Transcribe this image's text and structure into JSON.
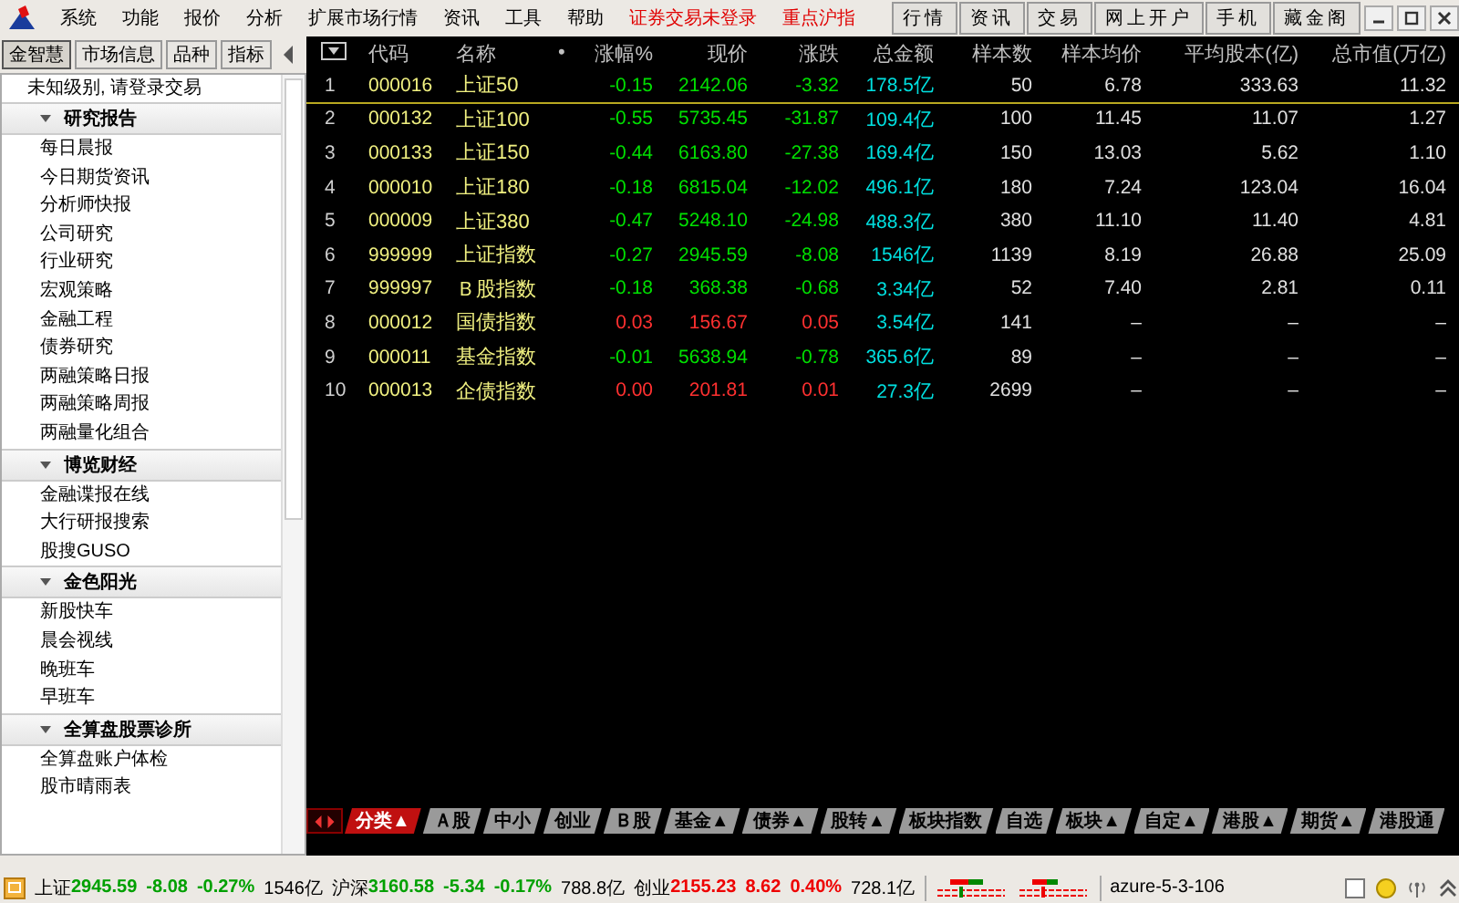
{
  "menu": [
    "系统",
    "功能",
    "报价",
    "分析",
    "扩展市场行情",
    "资讯",
    "工具",
    "帮助"
  ],
  "alerts": [
    "证券交易未登录",
    "重点沪指"
  ],
  "toolbar": [
    "行情",
    "资讯",
    "交易",
    "网上开户",
    "手机",
    "藏金阁"
  ],
  "sidebar": {
    "tabs": [
      {
        "label": "金智慧",
        "selected": true
      },
      {
        "label": "市场信息",
        "selected": false
      },
      {
        "label": "品种",
        "selected": false
      },
      {
        "label": "指标",
        "selected": false
      }
    ],
    "notice": "未知级别, 请登录交易",
    "sections": [
      {
        "title": "研究报告",
        "expanded": true,
        "children": [
          "每日晨报",
          "今日期货资讯",
          "分析师快报",
          "公司研究",
          "行业研究",
          "宏观策略",
          "金融工程",
          "债券研究",
          "两融策略日报",
          "两融策略周报",
          "两融量化组合"
        ]
      },
      {
        "title": "博览财经",
        "expanded": true,
        "children": [
          "金融谍报在线",
          "大行研报搜索",
          "股搜GUSO"
        ]
      },
      {
        "title": "金色阳光",
        "expanded": true,
        "children": [
          "新股快车",
          "晨会视线",
          "晚班车",
          "早班车"
        ]
      },
      {
        "title": "全算盘股票诊所",
        "expanded": true,
        "children": [
          "全算盘账户体检",
          "股市晴雨表"
        ]
      }
    ]
  },
  "table": {
    "columns": [
      "代码",
      "名称",
      "•",
      "涨幅%",
      "现价",
      "涨跌",
      "总金额",
      "样本数",
      "样本均价",
      "平均股本(亿)",
      "总市值(万亿)"
    ],
    "rows": [
      {
        "no": "1",
        "code": "000016",
        "name": "上证50",
        "pct": "-0.15",
        "price": "2142.06",
        "change": "-3.32",
        "amount": "178.5",
        "unit": "亿",
        "samples": "50",
        "avg_price": "6.78",
        "avg_cap": "333.63",
        "market_cap": "11.32",
        "rising": false,
        "selected": true
      },
      {
        "no": "2",
        "code": "000132",
        "name": "上证100",
        "pct": "-0.55",
        "price": "5735.45",
        "change": "-31.87",
        "amount": "109.4",
        "unit": "亿",
        "samples": "100",
        "avg_price": "11.45",
        "avg_cap": "11.07",
        "market_cap": "1.27",
        "rising": false,
        "selected": false
      },
      {
        "no": "3",
        "code": "000133",
        "name": "上证150",
        "pct": "-0.44",
        "price": "6163.80",
        "change": "-27.38",
        "amount": "169.4",
        "unit": "亿",
        "samples": "150",
        "avg_price": "13.03",
        "avg_cap": "5.62",
        "market_cap": "1.10",
        "rising": false,
        "selected": false
      },
      {
        "no": "4",
        "code": "000010",
        "name": "上证180",
        "pct": "-0.18",
        "price": "6815.04",
        "change": "-12.02",
        "amount": "496.1",
        "unit": "亿",
        "samples": "180",
        "avg_price": "7.24",
        "avg_cap": "123.04",
        "market_cap": "16.04",
        "rising": false,
        "selected": false
      },
      {
        "no": "5",
        "code": "000009",
        "name": "上证380",
        "pct": "-0.47",
        "price": "5248.10",
        "change": "-24.98",
        "amount": "488.3",
        "unit": "亿",
        "samples": "380",
        "avg_price": "11.10",
        "avg_cap": "11.40",
        "market_cap": "4.81",
        "rising": false,
        "selected": false
      },
      {
        "no": "6",
        "code": "999999",
        "name": "上证指数",
        "pct": "-0.27",
        "price": "2945.59",
        "change": "-8.08",
        "amount": "1546",
        "unit": "亿",
        "samples": "1139",
        "avg_price": "8.19",
        "avg_cap": "26.88",
        "market_cap": "25.09",
        "rising": false,
        "selected": false
      },
      {
        "no": "7",
        "code": "999997",
        "name": "Ｂ股指数",
        "pct": "-0.18",
        "price": "368.38",
        "change": "-0.68",
        "amount": "3.34",
        "unit": "亿",
        "samples": "52",
        "avg_price": "7.40",
        "avg_cap": "2.81",
        "market_cap": "0.11",
        "rising": false,
        "selected": false
      },
      {
        "no": "8",
        "code": "000012",
        "name": "国债指数",
        "pct": "0.03",
        "price": "156.67",
        "change": "0.05",
        "amount": "3.54",
        "unit": "亿",
        "samples": "141",
        "avg_price": "–",
        "avg_cap": "–",
        "market_cap": "–",
        "rising": true,
        "selected": false
      },
      {
        "no": "9",
        "code": "000011",
        "name": "基金指数",
        "pct": "-0.01",
        "price": "5638.94",
        "change": "-0.78",
        "amount": "365.6",
        "unit": "亿",
        "samples": "89",
        "avg_price": "–",
        "avg_cap": "–",
        "market_cap": "–",
        "rising": false,
        "selected": false
      },
      {
        "no": "10",
        "code": "000013",
        "name": "企债指数",
        "pct": "0.00",
        "price": "201.81",
        "change": "0.01",
        "amount": "27.3",
        "unit": "亿",
        "samples": "2699",
        "avg_price": "–",
        "avg_cap": "–",
        "market_cap": "–",
        "rising": true,
        "selected": false
      }
    ]
  },
  "bottom_tabs": [
    {
      "label": "分类▲",
      "selected": true
    },
    {
      "label": "Ａ股",
      "selected": false
    },
    {
      "label": "中小",
      "selected": false
    },
    {
      "label": "创业",
      "selected": false
    },
    {
      "label": "Ｂ股",
      "selected": false
    },
    {
      "label": "基金▲",
      "selected": false
    },
    {
      "label": "债券▲",
      "selected": false
    },
    {
      "label": "股转▲",
      "selected": false
    },
    {
      "label": "板块指数",
      "selected": false
    },
    {
      "label": "自选",
      "selected": false
    },
    {
      "label": "板块▲",
      "selected": false
    },
    {
      "label": "自定▲",
      "selected": false
    },
    {
      "label": "港股▲",
      "selected": false
    },
    {
      "label": "期货▲",
      "selected": false
    },
    {
      "label": "港股通",
      "selected": false
    }
  ],
  "status_bar": {
    "indices": [
      {
        "name": "上证",
        "price": "2945.59",
        "change": "-8.08",
        "pct": "-0.27%",
        "amount": "1546亿",
        "rising": false
      },
      {
        "name": "沪深",
        "price": "3160.58",
        "change": "-5.34",
        "pct": "-0.17%",
        "amount": "788.8亿",
        "rising": false
      },
      {
        "name": "创业",
        "price": "2155.23",
        "change": "8.62",
        "pct": "0.40%",
        "amount": "728.1亿",
        "rising": true
      }
    ],
    "server": "azure-5-3-106"
  }
}
